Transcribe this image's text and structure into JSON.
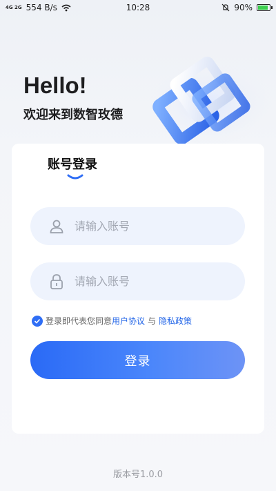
{
  "status_bar": {
    "signal": "4G 2G",
    "network_speed": "554 B/s",
    "time": "10:28",
    "battery": "90%",
    "battery_level": 0.9
  },
  "header": {
    "greeting": "Hello!",
    "welcome": "欢迎来到数智玫德"
  },
  "login": {
    "tab_label": "账号登录",
    "account_placeholder": "请输入账号",
    "password_placeholder": "请输入账号",
    "agreement_prefix": "登录即代表您同意",
    "user_agreement": "用户协议",
    "agreement_and": "与",
    "privacy_policy": "隐私政策",
    "login_button": "登录"
  },
  "footer": {
    "version": "版本号1.0.0"
  },
  "colors": {
    "primary": "#2f6ef5",
    "link": "#2366e8",
    "field_bg": "#eef3fd"
  }
}
